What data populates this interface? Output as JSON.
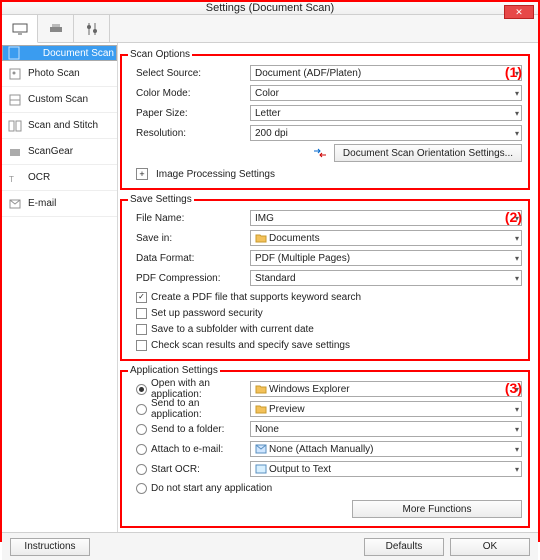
{
  "title": "Settings (Document Scan)",
  "sidebar": {
    "items": [
      {
        "label": "Document Scan"
      },
      {
        "label": "Photo Scan"
      },
      {
        "label": "Custom Scan"
      },
      {
        "label": "Scan and Stitch"
      },
      {
        "label": "ScanGear"
      },
      {
        "label": "OCR"
      },
      {
        "label": "E-mail"
      }
    ]
  },
  "legends": {
    "scan": "Scan Options",
    "save": "Save Settings",
    "app": "Application Settings"
  },
  "nums": {
    "s1": "(1)",
    "s2": "(2)",
    "s3": "(3)"
  },
  "scan": {
    "source_label": "Select Source:",
    "source_value": "Document (ADF/Platen)",
    "color_label": "Color Mode:",
    "color_value": "Color",
    "paper_label": "Paper Size:",
    "paper_value": "Letter",
    "res_label": "Resolution:",
    "res_value": "200 dpi",
    "orient_btn": "Document Scan Orientation Settings...",
    "img_proc": "Image Processing Settings"
  },
  "save": {
    "fname_label": "File Name:",
    "fname_value": "IMG",
    "savein_label": "Save in:",
    "savein_value": "Documents",
    "format_label": "Data Format:",
    "format_value": "PDF (Multiple Pages)",
    "comp_label": "PDF Compression:",
    "comp_value": "Standard",
    "chk1": "Create a PDF file that supports keyword search",
    "chk2": "Set up password security",
    "chk3": "Save to a subfolder with current date",
    "chk4": "Check scan results and specify save settings"
  },
  "app": {
    "r1": "Open with an application:",
    "r1v": "Windows Explorer",
    "r2": "Send to an application:",
    "r2v": "Preview",
    "r3": "Send to a folder:",
    "r3v": "None",
    "r4": "Attach to e-mail:",
    "r4v": "None (Attach Manually)",
    "r5": "Start OCR:",
    "r5v": "Output to Text",
    "r6": "Do not start any application",
    "more": "More Functions"
  },
  "bottom": {
    "instructions": "Instructions",
    "defaults": "Defaults",
    "ok": "OK"
  }
}
